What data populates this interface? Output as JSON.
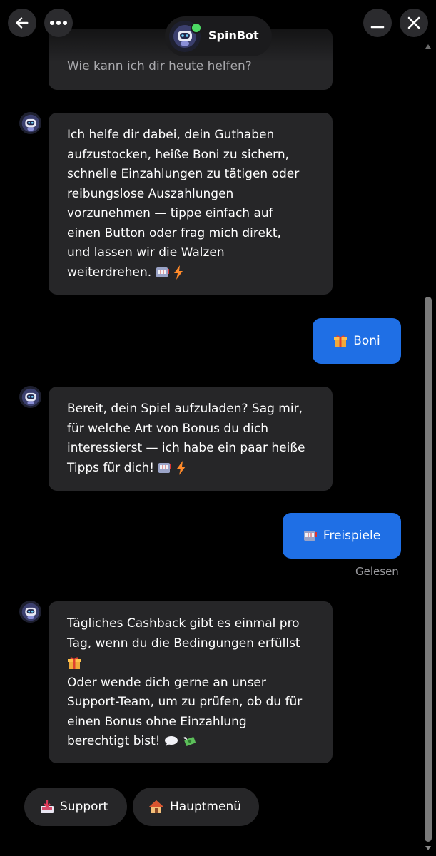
{
  "header": {
    "bot_name": "SpinBot",
    "icons": {
      "back": "arrow-left-icon",
      "more": "more-horizontal-icon",
      "minimize": "minimize-icon",
      "close": "close-icon",
      "avatar": "robot-icon"
    },
    "status_color": "#4cd964"
  },
  "messages": {
    "greeting": "Wie kann ich dir heute helfen?",
    "bot_1": {
      "lines": [
        "Ich helfe dir dabei, dein Guthaben",
        "aufzustocken, heiße Boni zu sichern,",
        "schnelle Einzahlungen zu tätigen oder",
        "reibungslose Auszahlungen",
        "vorzunehmen — tippe einfach auf",
        "einen Button oder frag mich direkt,",
        "und lassen wir die Walzen",
        "weiterdrehen."
      ],
      "emojis": [
        "slot-machine-icon",
        "lightning-icon"
      ]
    },
    "user_1": {
      "label": "Boni",
      "emoji": "gift-icon"
    },
    "bot_2": {
      "lines": [
        "Bereit, dein Spiel aufzuladen? Sag mir,",
        "für welche Art von Bonus du dich",
        "interessierst — ich habe ein paar heiße",
        "Tipps für dich!"
      ],
      "emojis": [
        "slot-machine-icon",
        "lightning-icon"
      ]
    },
    "user_2": {
      "label": "Freispiele",
      "emoji": "slot-machine-icon"
    },
    "read_status": "Gelesen",
    "bot_3": {
      "lines": [
        "Tägliches Cashback gibt es einmal pro",
        "Tag, wenn du die Bedingungen erfüllst",
        "",
        "Oder wende dich gerne an unser",
        "Support-Team, um zu prüfen, ob du für",
        "einen Bonus ohne Einzahlung",
        "berechtigt bist!"
      ],
      "emojis": [
        "gift-icon",
        "speech-bubble-icon",
        "money-wings-icon"
      ]
    }
  },
  "quick_replies": [
    {
      "label": "Support",
      "icon": "inbox-tray-icon"
    },
    {
      "label": "Hauptmenü",
      "icon": "house-icon"
    }
  ],
  "colors": {
    "background": "#000000",
    "bot_bubble": "#262628",
    "user_bubble": "#1f6fe5",
    "muted_text": "#9a9a9e"
  }
}
